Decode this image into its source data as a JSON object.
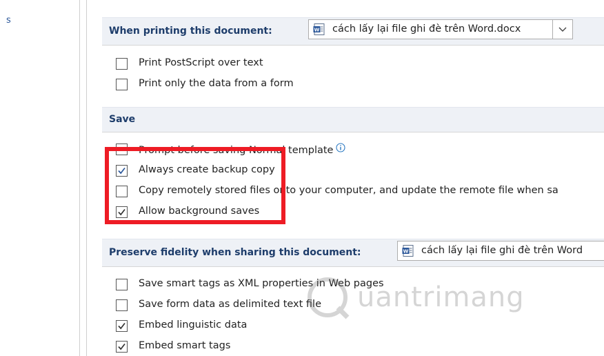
{
  "left_nav": {
    "label": "s"
  },
  "printing": {
    "header": "When printing this document:",
    "doc_select_value": "cách lấy lại file ghi đè trên Word.docx",
    "options": [
      {
        "label": "Print PostScript over text",
        "checked": false
      },
      {
        "label": "Print only the data from a form",
        "checked": false
      }
    ]
  },
  "save": {
    "header": "Save",
    "options": [
      {
        "label": "Prompt before saving Normal template",
        "checked": false
      },
      {
        "label": "Always create backup copy",
        "checked": true
      },
      {
        "label": "Copy remotely stored files onto your computer, and update the remote file when sa",
        "checked": false
      },
      {
        "label": "Allow background saves",
        "checked": true
      }
    ]
  },
  "fidelity": {
    "header": "Preserve fidelity when sharing this document:",
    "doc_select_value": "cách lấy lại file ghi đè trên Word",
    "options": [
      {
        "label": "Save smart tags as XML properties in Web pages",
        "checked": false
      },
      {
        "label": "Save form data as delimited text file",
        "checked": false
      },
      {
        "label": "Embed linguistic data",
        "checked": true
      },
      {
        "label": "Embed smart tags",
        "checked": true
      }
    ]
  },
  "watermark": {
    "text": "uantrimang"
  },
  "colors": {
    "highlight": "#ee1c25",
    "header_text": "#1e3d6b",
    "header_bg": "#eef1f6"
  }
}
